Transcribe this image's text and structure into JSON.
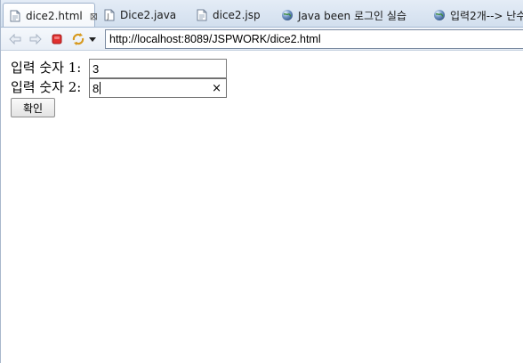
{
  "tabs": [
    {
      "label": "dice2.html",
      "icon": "html-file-icon",
      "active": true,
      "closable": true
    },
    {
      "label": "Dice2.java",
      "icon": "java-file-icon",
      "active": false
    },
    {
      "label": "dice2.jsp",
      "icon": "jsp-file-icon",
      "active": false
    },
    {
      "label": "Java been 로그인 실습",
      "icon": "globe-icon",
      "active": false
    },
    {
      "label": "입력2개--> 난수",
      "icon": "globe-icon",
      "active": false
    }
  ],
  "toolbar": {
    "back_icon": "back-arrow-icon",
    "forward_icon": "forward-arrow-icon",
    "stop_icon": "stop-icon",
    "refresh_icon": "refresh-icon",
    "menu_icon": "dropdown-arrow-icon",
    "url": "http://localhost:8089/JSPWORK/dice2.html"
  },
  "form": {
    "input1_label": "입력 숫자 1:",
    "input1_value": "3",
    "input2_label": "입력 숫자 2:",
    "input2_value": "8",
    "clear_symbol": "×",
    "submit_label": "확인"
  },
  "colors": {
    "tabbar_bg": "#d2dfee",
    "stop_red": "#e03030"
  }
}
